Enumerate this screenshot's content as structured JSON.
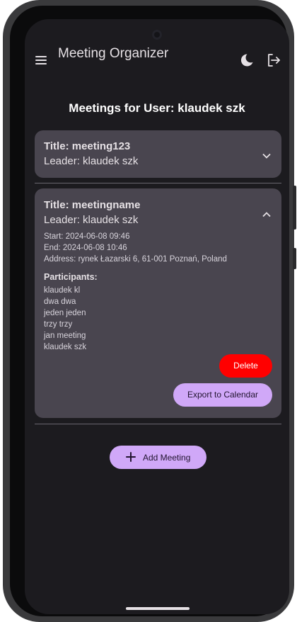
{
  "appbar": {
    "title": "Meeting Organizer",
    "icons": [
      "menu-icon",
      "moon-icon",
      "logout-icon"
    ]
  },
  "page": {
    "heading": "Meetings for User: klaudek szk"
  },
  "meetings": [
    {
      "title": "Title: meeting123",
      "leader": "Leader: klaudek szk",
      "expanded": false
    },
    {
      "title": "Title: meetingname",
      "leader": "Leader: klaudek szk",
      "expanded": true,
      "start": "Start: 2024-06-08 09:46",
      "end": "End: 2024-06-08 10:46",
      "address": "Address: rynek Łazarski 6, 61-001 Poznań, Poland",
      "participants_heading": "Participants:",
      "participants": [
        "klaudek kl",
        "dwa dwa",
        "jeden jeden",
        "trzy trzy",
        "jan meeting",
        "klaudek szk"
      ],
      "delete_label": "Delete",
      "export_label": "Export to Calendar"
    }
  ],
  "actions": {
    "add_meeting_label": "Add Meeting"
  },
  "colors": {
    "background": "#1c1b1f",
    "card": "#49454f",
    "primary": "#d0a8f8",
    "danger": "#ff0000"
  }
}
